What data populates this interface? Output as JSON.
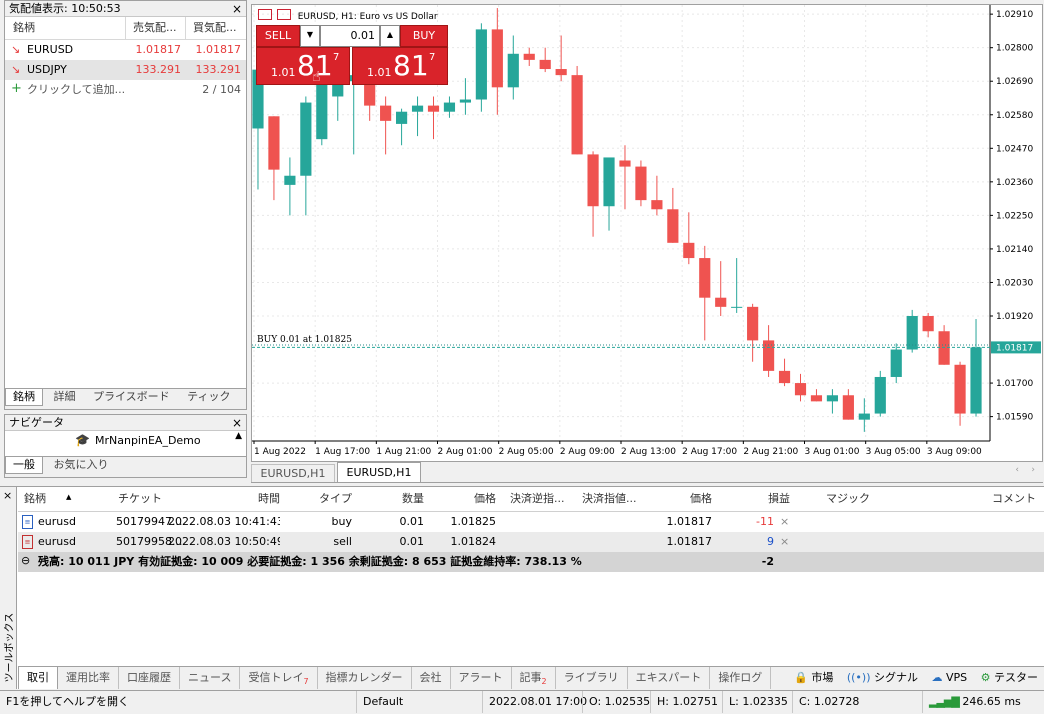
{
  "market_watch": {
    "title": "気配値表示: 10:50:53",
    "columns": [
      "銘柄",
      "売気配...",
      "買気配..."
    ],
    "rows": [
      {
        "symbol": "EURUSD",
        "bid": "1.01817",
        "ask": "1.01817"
      },
      {
        "symbol": "USDJPY",
        "bid": "133.291",
        "ask": "133.291"
      }
    ],
    "add_label": "クリックして追加...",
    "count": "2 / 104",
    "tabs": [
      "銘柄",
      "詳細",
      "プライスボード",
      "ティック"
    ]
  },
  "navigator": {
    "title": "ナビゲータ",
    "item": "MrNanpinEA_Demo",
    "tabs": [
      "一般",
      "お気に入り"
    ]
  },
  "chart": {
    "symbol_title": "EURUSD, H1:  Euro vs US Dollar",
    "sell_label": "SELL",
    "buy_label": "BUY",
    "lot": "0.01",
    "sell_price": {
      "prefix": "1.01",
      "big": "81",
      "sup": "7"
    },
    "buy_price": {
      "prefix": "1.01",
      "big": "81",
      "sup": "7"
    },
    "order_line_label": "BUY 0.01 at 1.01825",
    "current_price_label": "1.01817",
    "tabs": [
      "EURUSD,H1",
      "EURUSD,H1"
    ],
    "colors": {
      "bull": "#26a69a",
      "bear": "#ef5350",
      "price_line": "#26a69a"
    }
  },
  "chart_data": {
    "type": "candlestick",
    "title": "EURUSD, H1:  Euro vs US Dollar",
    "y_ticks": [
      "1.02910",
      "1.02800",
      "1.02690",
      "1.02580",
      "1.02470",
      "1.02360",
      "1.02250",
      "1.02140",
      "1.02030",
      "1.01920",
      "1.01700",
      "1.01590"
    ],
    "x_ticks": [
      "1 Aug 2022",
      "1 Aug 17:00",
      "1 Aug 21:00",
      "2 Aug 01:00",
      "2 Aug 05:00",
      "2 Aug 09:00",
      "2 Aug 13:00",
      "2 Aug 17:00",
      "2 Aug 21:00",
      "3 Aug 01:00",
      "3 Aug 05:00",
      "3 Aug 09:00"
    ],
    "ylim": [
      1.0151,
      1.0294
    ],
    "candles": [
      {
        "o": 1.02535,
        "h": 1.02751,
        "l": 1.02335,
        "c": 1.02728
      },
      {
        "o": 1.02575,
        "h": 1.02575,
        "l": 1.023,
        "c": 1.024
      },
      {
        "o": 1.0235,
        "h": 1.0244,
        "l": 1.0225,
        "c": 1.0238
      },
      {
        "o": 1.0238,
        "h": 1.0264,
        "l": 1.0225,
        "c": 1.0262
      },
      {
        "o": 1.025,
        "h": 1.0272,
        "l": 1.0248,
        "c": 1.0272
      },
      {
        "o": 1.0264,
        "h": 1.0272,
        "l": 1.0256,
        "c": 1.0272
      },
      {
        "o": 1.0269,
        "h": 1.0272,
        "l": 1.0245,
        "c": 1.0271
      },
      {
        "o": 1.0271,
        "h": 1.0272,
        "l": 1.0256,
        "c": 1.0261
      },
      {
        "o": 1.0261,
        "h": 1.0264,
        "l": 1.0245,
        "c": 1.0256
      },
      {
        "o": 1.0255,
        "h": 1.026,
        "l": 1.0248,
        "c": 1.0259
      },
      {
        "o": 1.0259,
        "h": 1.0264,
        "l": 1.0251,
        "c": 1.0261
      },
      {
        "o": 1.0261,
        "h": 1.0264,
        "l": 1.025,
        "c": 1.0259
      },
      {
        "o": 1.0259,
        "h": 1.0264,
        "l": 1.0257,
        "c": 1.0262
      },
      {
        "o": 1.0262,
        "h": 1.027,
        "l": 1.0258,
        "c": 1.0263
      },
      {
        "o": 1.0263,
        "h": 1.0288,
        "l": 1.0259,
        "c": 1.0286
      },
      {
        "o": 1.0286,
        "h": 1.0293,
        "l": 1.0258,
        "c": 1.0267
      },
      {
        "o": 1.0267,
        "h": 1.0284,
        "l": 1.0263,
        "c": 1.0278
      },
      {
        "o": 1.0278,
        "h": 1.028,
        "l": 1.0274,
        "c": 1.0276
      },
      {
        "o": 1.0276,
        "h": 1.028,
        "l": 1.0272,
        "c": 1.0273
      },
      {
        "o": 1.0273,
        "h": 1.0284,
        "l": 1.0269,
        "c": 1.0271
      },
      {
        "o": 1.0271,
        "h": 1.0274,
        "l": 1.0245,
        "c": 1.0245
      },
      {
        "o": 1.0245,
        "h": 1.0246,
        "l": 1.0218,
        "c": 1.0228
      },
      {
        "o": 1.0228,
        "h": 1.0243,
        "l": 1.022,
        "c": 1.0244
      },
      {
        "o": 1.0243,
        "h": 1.0248,
        "l": 1.0227,
        "c": 1.0241
      },
      {
        "o": 1.0241,
        "h": 1.0243,
        "l": 1.0228,
        "c": 1.023
      },
      {
        "o": 1.023,
        "h": 1.0238,
        "l": 1.0225,
        "c": 1.0227
      },
      {
        "o": 1.0227,
        "h": 1.0234,
        "l": 1.0216,
        "c": 1.0216
      },
      {
        "o": 1.0216,
        "h": 1.0226,
        "l": 1.0209,
        "c": 1.0211
      },
      {
        "o": 1.0211,
        "h": 1.0215,
        "l": 1.0184,
        "c": 1.0198
      },
      {
        "o": 1.0198,
        "h": 1.021,
        "l": 1.0192,
        "c": 1.0195
      },
      {
        "o": 1.0195,
        "h": 1.0211,
        "l": 1.0193,
        "c": 1.0195
      },
      {
        "o": 1.0195,
        "h": 1.0196,
        "l": 1.0177,
        "c": 1.0184
      },
      {
        "o": 1.0184,
        "h": 1.0189,
        "l": 1.0172,
        "c": 1.0174
      },
      {
        "o": 1.0174,
        "h": 1.0178,
        "l": 1.0169,
        "c": 1.017
      },
      {
        "o": 1.017,
        "h": 1.0173,
        "l": 1.0164,
        "c": 1.0166
      },
      {
        "o": 1.0166,
        "h": 1.0168,
        "l": 1.0164,
        "c": 1.0164
      },
      {
        "o": 1.0164,
        "h": 1.0168,
        "l": 1.016,
        "c": 1.0166
      },
      {
        "o": 1.0166,
        "h": 1.0168,
        "l": 1.0158,
        "c": 1.0158
      },
      {
        "o": 1.0158,
        "h": 1.0165,
        "l": 1.0154,
        "c": 1.016
      },
      {
        "o": 1.016,
        "h": 1.0174,
        "l": 1.0159,
        "c": 1.0172
      },
      {
        "o": 1.0172,
        "h": 1.0183,
        "l": 1.017,
        "c": 1.0181
      },
      {
        "o": 1.0181,
        "h": 1.0194,
        "l": 1.018,
        "c": 1.0192
      },
      {
        "o": 1.0192,
        "h": 1.0193,
        "l": 1.0185,
        "c": 1.0187
      },
      {
        "o": 1.0187,
        "h": 1.0189,
        "l": 1.0176,
        "c": 1.0176
      },
      {
        "o": 1.0176,
        "h": 1.0177,
        "l": 1.0156,
        "c": 1.016
      },
      {
        "o": 1.016,
        "h": 1.0191,
        "l": 1.0159,
        "c": 1.01817
      }
    ]
  },
  "toolbox": {
    "side_label": "ツールボックス",
    "columns": [
      "銘柄",
      "チケット",
      "時間",
      "タイプ",
      "数量",
      "価格",
      "決済逆指...",
      "決済指値...",
      "価格",
      "損益",
      "マジック",
      "コメント"
    ],
    "trades": [
      {
        "symbol": "eurusd",
        "ticket": "50179947...",
        "time": "2022.08.03 10:41:43",
        "type": "buy",
        "volume": "0.01",
        "price": "1.01825",
        "sl": "",
        "tp": "",
        "cur_price": "1.01817",
        "profit": "-11"
      },
      {
        "symbol": "eurusd",
        "ticket": "50179958...",
        "time": "2022.08.03 10:50:49",
        "type": "sell",
        "volume": "0.01",
        "price": "1.01824",
        "sl": "",
        "tp": "",
        "cur_price": "1.01817",
        "profit": "9"
      }
    ],
    "summary": "残高: 10 011 JPY  有効証拠金: 10 009  必要証拠金: 1 356  余剰証拠金: 8 653  証拠金維持率: 738.13 %",
    "summary_total": "-2",
    "tabs": [
      {
        "label": "取引",
        "badge": ""
      },
      {
        "label": "運用比率",
        "badge": ""
      },
      {
        "label": "口座履歴",
        "badge": ""
      },
      {
        "label": "ニュース",
        "badge": ""
      },
      {
        "label": "受信トレイ",
        "badge": "7"
      },
      {
        "label": "指標カレンダー",
        "badge": ""
      },
      {
        "label": "会社",
        "badge": ""
      },
      {
        "label": "アラート",
        "badge": ""
      },
      {
        "label": "記事",
        "badge": "2"
      },
      {
        "label": "ライブラリ",
        "badge": ""
      },
      {
        "label": "エキスパート",
        "badge": ""
      },
      {
        "label": "操作ログ",
        "badge": ""
      }
    ],
    "right_tools": [
      "市場",
      "シグナル",
      "VPS",
      "テスター"
    ]
  },
  "status_bar": {
    "help": "F1を押してヘルプを開く",
    "profile": "Default",
    "datetime": "2022.08.01 17:00",
    "open": "O: 1.02535",
    "high": "H: 1.02751",
    "low": "L: 1.02335",
    "close": "C: 1.02728",
    "ping": "246.65 ms"
  }
}
